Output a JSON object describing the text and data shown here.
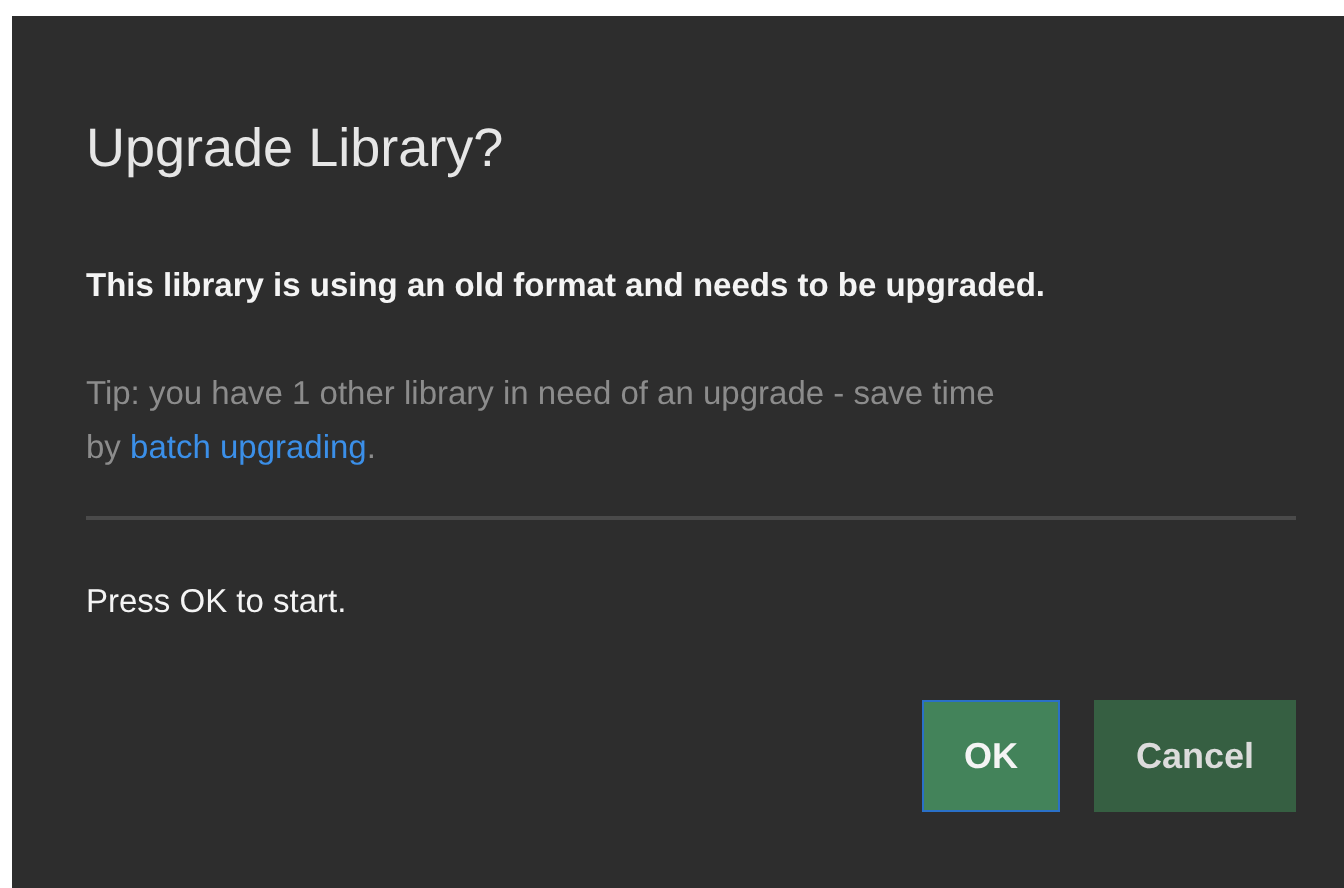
{
  "dialog": {
    "title": "Upgrade Library?",
    "message": "This library is using an old format and needs to be upgraded.",
    "tip": {
      "text_before": "Tip: you have 1 other library in need of an upgrade - save time by",
      "link": "batch upgrading",
      "text_after": "."
    },
    "prompt": "Press OK to start.",
    "buttons": [
      {
        "label": "OK",
        "focused": true
      },
      {
        "label": "Cancel",
        "focused": false
      }
    ]
  }
}
